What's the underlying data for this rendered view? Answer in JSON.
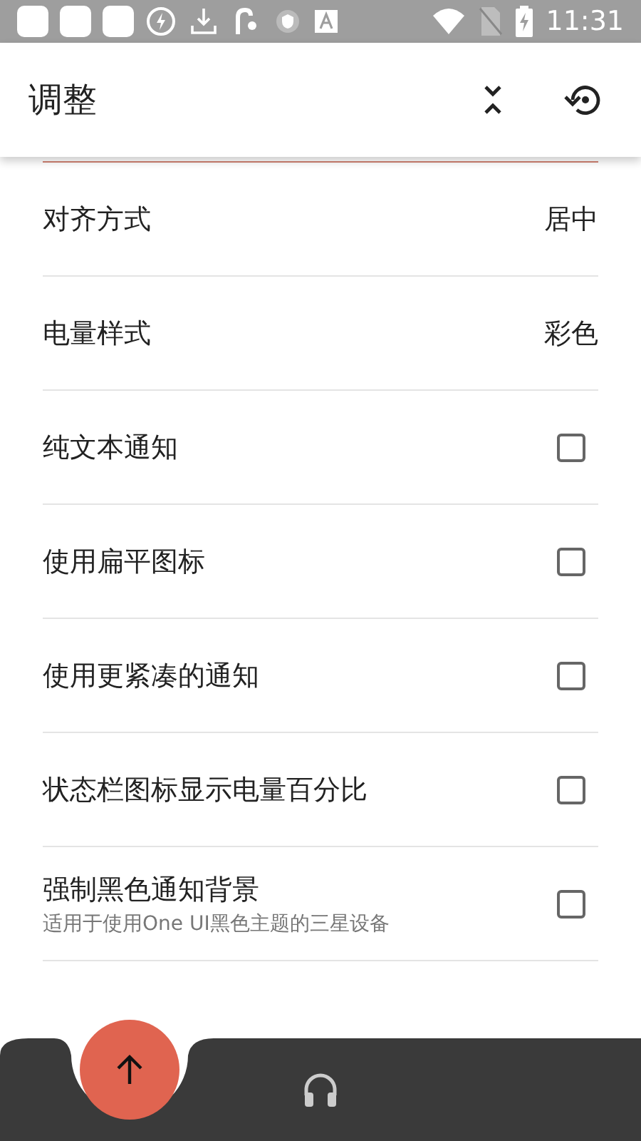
{
  "status_bar": {
    "time": "11:31"
  },
  "app_bar": {
    "title": "调整"
  },
  "settings": [
    {
      "kind": "value",
      "label": "对齐方式",
      "value": "居中"
    },
    {
      "kind": "value",
      "label": "电量样式",
      "value": "彩色"
    },
    {
      "kind": "checkbox",
      "label": "纯文本通知",
      "checked": false
    },
    {
      "kind": "checkbox",
      "label": "使用扁平图标",
      "checked": false
    },
    {
      "kind": "checkbox",
      "label": "使用更紧凑的通知",
      "checked": false
    },
    {
      "kind": "checkbox",
      "label": "状态栏图标显示电量百分比",
      "checked": false
    },
    {
      "kind": "checkbox",
      "label": "强制黑色通知背景",
      "description": "适用于使用One UI黑色主题的三星设备",
      "checked": false
    }
  ]
}
